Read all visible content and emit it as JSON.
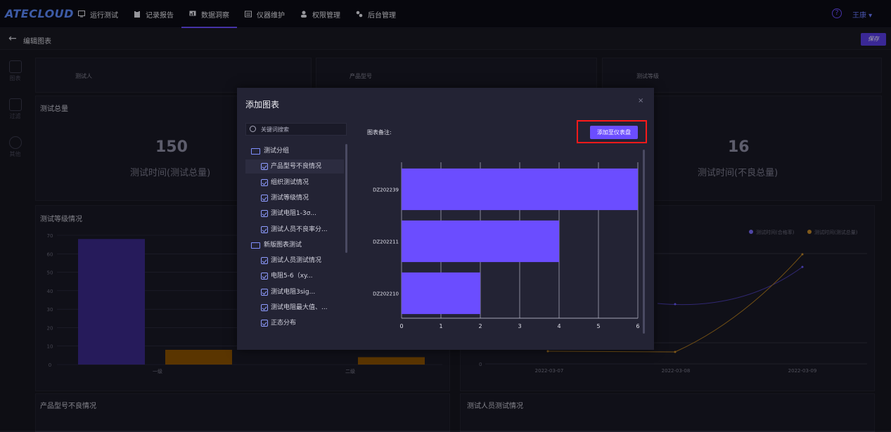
{
  "app": {
    "logo": "ATECLOUD",
    "nav": [
      {
        "label": "运行测试",
        "icon": "monitor-icon"
      },
      {
        "label": "记录报告",
        "icon": "clipboard-icon"
      },
      {
        "label": "数据洞察",
        "icon": "chart-monitor-icon",
        "active": true
      },
      {
        "label": "仪器维护",
        "icon": "instrument-icon"
      },
      {
        "label": "权限管理",
        "icon": "users-icon"
      },
      {
        "label": "后台管理",
        "icon": "settings-cluster-icon"
      }
    ],
    "help": "?",
    "user": "王康 ▾"
  },
  "subbar": {
    "back": "←",
    "title": "编辑图表",
    "save": "保存"
  },
  "sidebar": [
    {
      "label": "图表",
      "icon": "chart-icon"
    },
    {
      "label": "过滤",
      "icon": "filter-search-icon"
    },
    {
      "label": "其他",
      "icon": "cube-icon"
    }
  ],
  "dashboard": {
    "filters": [
      "测试人",
      "产品型号",
      "测试等级"
    ],
    "total_card": {
      "title": "测试总量",
      "value": "150",
      "caption": "测试时间(测试总量)"
    },
    "bad_card": {
      "value": "16",
      "caption": "测试时间(不良总量)"
    },
    "level_card": {
      "title": "测试等级情况",
      "y_ticks": [
        "70",
        "60",
        "50",
        "40",
        "30",
        "20",
        "10",
        "0"
      ],
      "categories": [
        "一级",
        "二级"
      ]
    },
    "line_card": {
      "legend": [
        "测试时间(合格率)",
        "测试时间(测试总量)"
      ],
      "x_ticks": [
        "2022-03-07",
        "2022-03-08",
        "2022-03-09"
      ],
      "y_tick_zero": "0"
    },
    "bottom_titles": [
      "产品型号不良情况",
      "测试人员测试情况"
    ]
  },
  "modal": {
    "title": "添加图表",
    "close": "×",
    "search_placeholder": "关键词搜索",
    "note_label": "图表备注:",
    "add_button": "添加至仪表盘",
    "tree": [
      {
        "type": "folder",
        "label": "测试分组"
      },
      {
        "type": "item",
        "label": "产品型号不良情况",
        "selected": true
      },
      {
        "type": "item",
        "label": "组织测试情况"
      },
      {
        "type": "item",
        "label": "测试等级情况"
      },
      {
        "type": "item",
        "label": "测试电阻1-3σ..."
      },
      {
        "type": "item",
        "label": "测试人员不良率分..."
      },
      {
        "type": "folder",
        "label": "新版图表测试"
      },
      {
        "type": "item",
        "label": "测试人员测试情况"
      },
      {
        "type": "item",
        "label": "电阻5-6（xy..."
      },
      {
        "type": "item",
        "label": "测试电阻3sig..."
      },
      {
        "type": "item",
        "label": "测试电阻最大值、..."
      },
      {
        "type": "item",
        "label": "正态分布"
      }
    ]
  },
  "chart_data": [
    {
      "type": "bar",
      "orientation": "horizontal",
      "categories": [
        "DZ202239",
        "DZ202211",
        "DZ202210"
      ],
      "values": [
        6,
        4,
        2
      ],
      "xlim": [
        0,
        6
      ],
      "x_ticks": [
        "0",
        "1",
        "2",
        "3",
        "4",
        "5",
        "6"
      ],
      "color": "#6b4dff",
      "grid": true
    },
    {
      "type": "bar",
      "categories": [
        "一级",
        "二级"
      ],
      "series": [
        {
          "values": [
            68,
            null
          ],
          "color": "#3b2a8c"
        },
        {
          "values": [
            8,
            4
          ],
          "color": "#8a5200"
        }
      ],
      "ylim": [
        0,
        70
      ]
    }
  ]
}
